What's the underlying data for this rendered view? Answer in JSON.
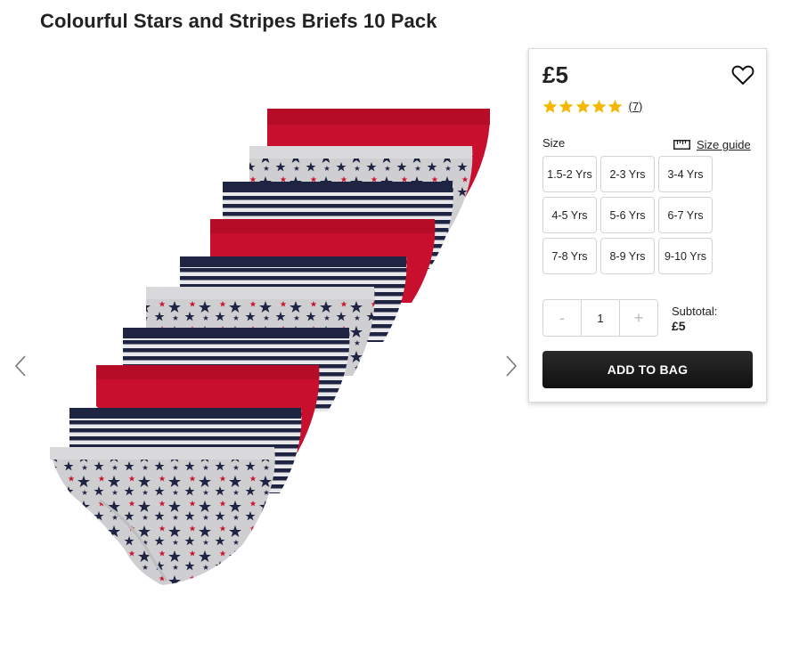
{
  "product": {
    "title": "Colourful Stars and Stripes Briefs 10 Pack"
  },
  "gallery": {
    "prev_icon": "chevron-left-icon",
    "next_icon": "chevron-right-icon"
  },
  "purchase": {
    "price": "£5",
    "wishlist_icon": "heart-icon",
    "rating": {
      "stars": 5,
      "review_count": "(7)",
      "star_color": "#f5b800"
    },
    "size_label": "Size",
    "size_guide_label": "Size guide",
    "size_guide_icon": "ruler-icon",
    "sizes": [
      "1.5-2 Yrs",
      "2-3 Yrs",
      "3-4 Yrs",
      "4-5 Yrs",
      "5-6 Yrs",
      "6-7 Yrs",
      "7-8 Yrs",
      "8-9 Yrs",
      "9-10 Yrs"
    ],
    "quantity": {
      "minus": "-",
      "value": "1",
      "plus": "+"
    },
    "subtotal_label": "Subtotal:",
    "subtotal_value": "£5",
    "add_to_bag_label": "ADD TO BAG"
  },
  "colors": {
    "red": "#c8102e",
    "navy": "#1f2443",
    "grey": "#cfcfd1"
  }
}
